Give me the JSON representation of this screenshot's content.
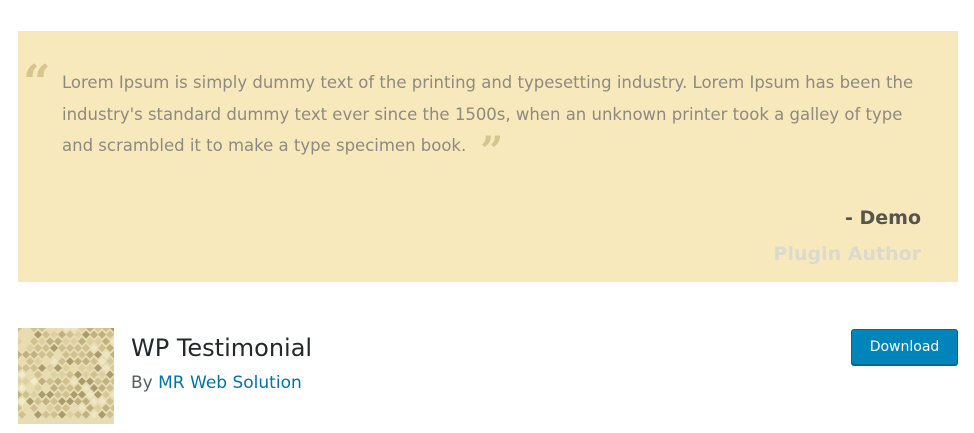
{
  "banner": {
    "quote": "Lorem Ipsum is simply dummy text of the printing and typesetting industry. Lorem Ipsum has been the industry's standard dummy text ever since the 1500s, when an unknown printer took a galley of type and scrambled it to make a type specimen book.",
    "quote_open_glyph": "“",
    "quote_close_glyph": "”",
    "author_name": "- Demo",
    "author_role": "Plugin Author",
    "background_color": "#f8e9bc"
  },
  "plugin": {
    "icon": "geometric-pattern-icon",
    "title": "WP Testimonial",
    "by_prefix": "By ",
    "author": "MR Web Solution",
    "download_label": "Download",
    "accent_color": "#0085ba"
  }
}
